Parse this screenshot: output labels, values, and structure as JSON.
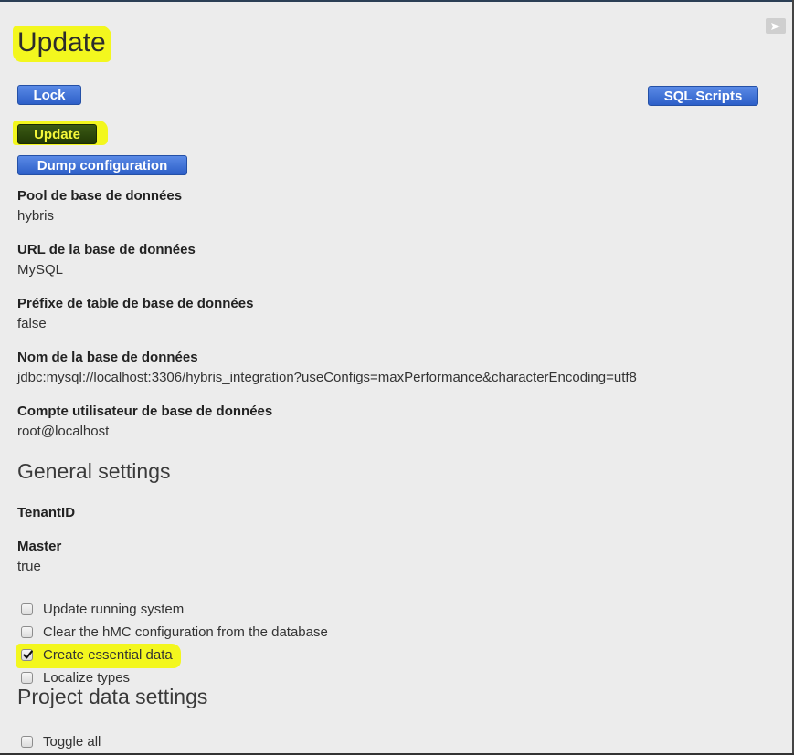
{
  "page": {
    "title": "Update",
    "collapse_icon": "triangle-right-icon",
    "highlight_color": "#f3f71e"
  },
  "buttons": {
    "lock": "Lock",
    "sql_scripts": "SQL Scripts",
    "update": "Update",
    "dump_configuration": "Dump configuration"
  },
  "database": {
    "pool_label": "Pool de base de données",
    "pool_value": "hybris",
    "url_label": "URL de la base de données",
    "url_value": "MySQL",
    "prefix_label": "Préfixe de table de base de données",
    "prefix_value": "false",
    "name_label": "Nom de la base de données",
    "name_value": "jdbc:mysql://localhost:3306/hybris_integration?useConfigs=maxPerformance&characterEncoding=utf8",
    "user_label": "Compte utilisateur de base de données",
    "user_value": "root@localhost"
  },
  "general_settings": {
    "title": "General settings",
    "tenant_label": "TenantID",
    "master_label": "Master",
    "master_value": "true",
    "options": [
      {
        "label": "Update running system",
        "checked": false
      },
      {
        "label": "Clear the hMC configuration from the database",
        "checked": false
      },
      {
        "label": "Create essential data",
        "checked": true
      },
      {
        "label": "Localize types",
        "checked": false
      }
    ]
  },
  "project_data_settings": {
    "title": "Project data settings",
    "toggle_all": {
      "label": "Toggle all",
      "checked": false
    }
  }
}
